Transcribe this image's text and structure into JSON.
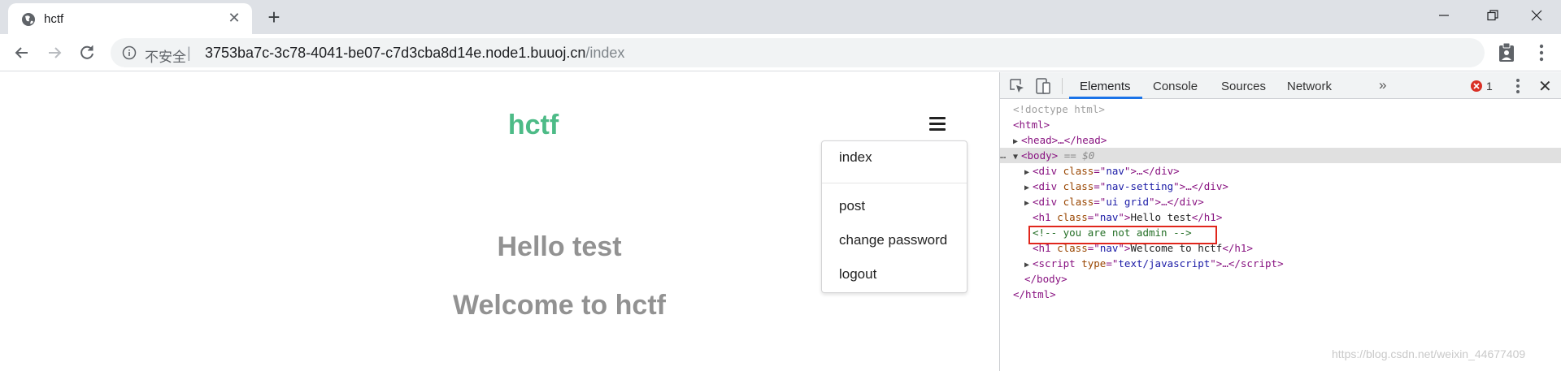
{
  "browser": {
    "tab_title": "hctf",
    "address": {
      "security_label": "不安全",
      "separator": "|",
      "url_host": "3753ba7c-3c78-4041-be07-c7d3cba8d14e.node1.buuoj.cn",
      "url_path": "/index"
    }
  },
  "page": {
    "brand": "hctf",
    "menu": [
      "index",
      "post",
      "change password",
      "logout"
    ],
    "heading1": "Hello test",
    "heading2": "Welcome to hctf"
  },
  "devtools": {
    "tabs": [
      "Elements",
      "Console",
      "Sources",
      "Network"
    ],
    "more": "»",
    "error_count": "1",
    "selected_suffix": "== $0",
    "dom": {
      "doctype": "<!doctype html>",
      "html_open": "<html>",
      "head": "<head>…</head>",
      "body_open": "<body>",
      "div_nav": [
        "<div ",
        "class",
        "=\"",
        "nav",
        "\">…</div>"
      ],
      "div_nav_setting_class": "nav-setting",
      "div_ui_grid_class": "ui grid",
      "h1_text": "Hello test",
      "comment": "<!-- you are not admin -->",
      "h1_welcome": "Welcome to hctf",
      "script_type": "text/javascript",
      "body_close": "</body>",
      "html_close": "</html>"
    }
  },
  "watermark": "https://blog.csdn.net/weixin_44677409"
}
